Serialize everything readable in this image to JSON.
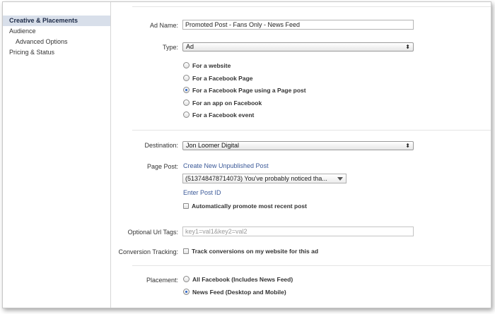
{
  "sidebar": {
    "items": [
      {
        "label": "Creative & Placements",
        "active": true
      },
      {
        "label": "Audience"
      },
      {
        "label": "Advanced Options"
      },
      {
        "label": "Pricing & Status"
      }
    ]
  },
  "form": {
    "ad_name": {
      "label": "Ad Name:",
      "value": "Promoted Post - Fans Only - News Feed"
    },
    "type": {
      "label": "Type:",
      "value": "Ad",
      "options": [
        {
          "label": "For a website",
          "selected": false
        },
        {
          "label": "For a Facebook Page",
          "selected": false
        },
        {
          "label": "For a Facebook Page using a Page post",
          "selected": true
        },
        {
          "label": "For an app on Facebook",
          "selected": false
        },
        {
          "label": "For a Facebook event",
          "selected": false
        }
      ]
    },
    "destination": {
      "label": "Destination:",
      "value": "Jon Loomer Digital"
    },
    "page_post": {
      "label": "Page Post:",
      "create_link": "Create New Unpublished Post",
      "selected_post": "(513748478714073) You've probably noticed tha...",
      "enter_id_link": "Enter Post ID",
      "auto_promote_label": "Automatically promote most recent post"
    },
    "url_tags": {
      "label": "Optional Url Tags:",
      "placeholder": "key1=val1&key2=val2"
    },
    "conversion": {
      "label": "Conversion Tracking:",
      "checkbox_label": "Track conversions on my website for this ad"
    },
    "placement": {
      "label": "Placement:",
      "options": [
        {
          "label": "All Facebook (Includes News Feed)",
          "selected": false
        },
        {
          "label": "News Feed (Desktop and Mobile)",
          "selected": true
        }
      ]
    }
  },
  "colors": {
    "accent": "#3b5998",
    "active_nav_bg": "#d8dfea"
  }
}
